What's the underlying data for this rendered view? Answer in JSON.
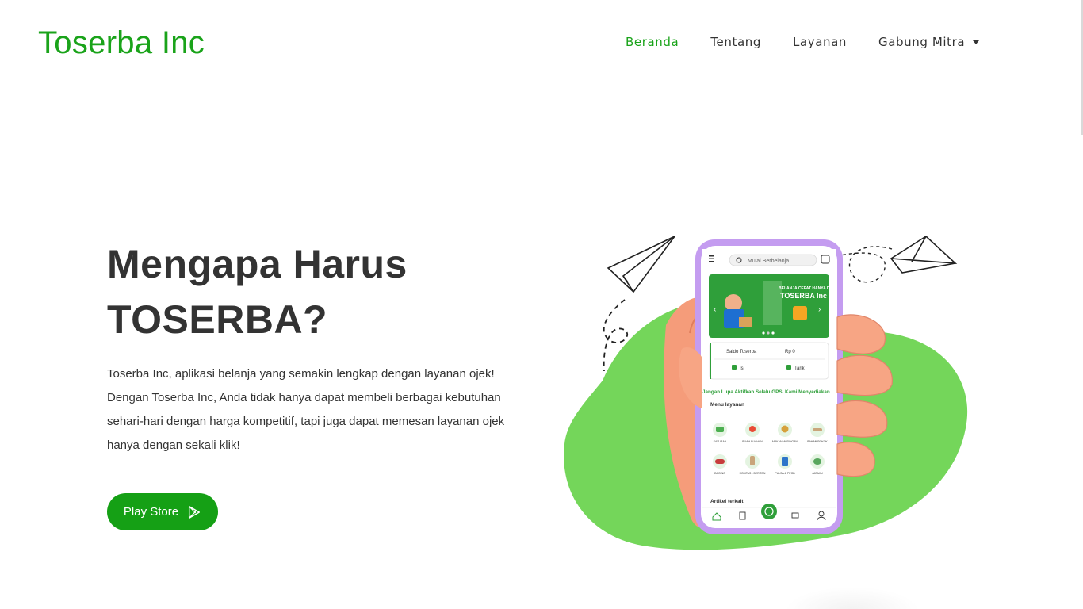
{
  "brand": {
    "name": "Toserba Inc",
    "color": "#1aa31a"
  },
  "nav": {
    "items": [
      {
        "label": "Beranda",
        "active": true
      },
      {
        "label": "Tentang",
        "active": false
      },
      {
        "label": "Layanan",
        "active": false
      },
      {
        "label": "Gabung Mitra",
        "active": false,
        "dropdown": true
      }
    ]
  },
  "hero": {
    "title_line1": "Mengapa Harus",
    "title_line2": "TOSERBA?",
    "paragraph": "Toserba Inc, aplikasi belanja yang semakin lengkap dengan layanan ojek! Dengan Toserba Inc, Anda tidak hanya dapat membeli berbagai kebutuhan sehari-hari dengan harga kompetitif, tapi juga dapat memesan layanan ojek hanya dengan sekali klik!",
    "button_label": "Play Store",
    "button_icon": "google-play-icon",
    "accent": "#15a015"
  },
  "phone": {
    "search_placeholder": "Mulai Berbelanja",
    "banner_line1": "BELANJA CEPAT HANYA DI",
    "banner_line2": "TOSERBA Inc",
    "saldo_label": "Saldo Toserba",
    "saldo_value": "Rp 0",
    "isi_label": "Isi",
    "tarik_label": "Tarik",
    "marquee": "Jangan Lupa Aktifkan Selalu GPS, Kami Menyediakan",
    "menu_title": "Menu layanan",
    "menu_items": [
      "SAYURAN",
      "BUAH-BUAHAN",
      "MAKANAN RINGAN",
      "BAHAN POKOK",
      "DAGING",
      "KOMPAS - BERITAN",
      "PULSA & PPOB",
      "JASAKU"
    ],
    "article_title": "Artikel terkait"
  }
}
